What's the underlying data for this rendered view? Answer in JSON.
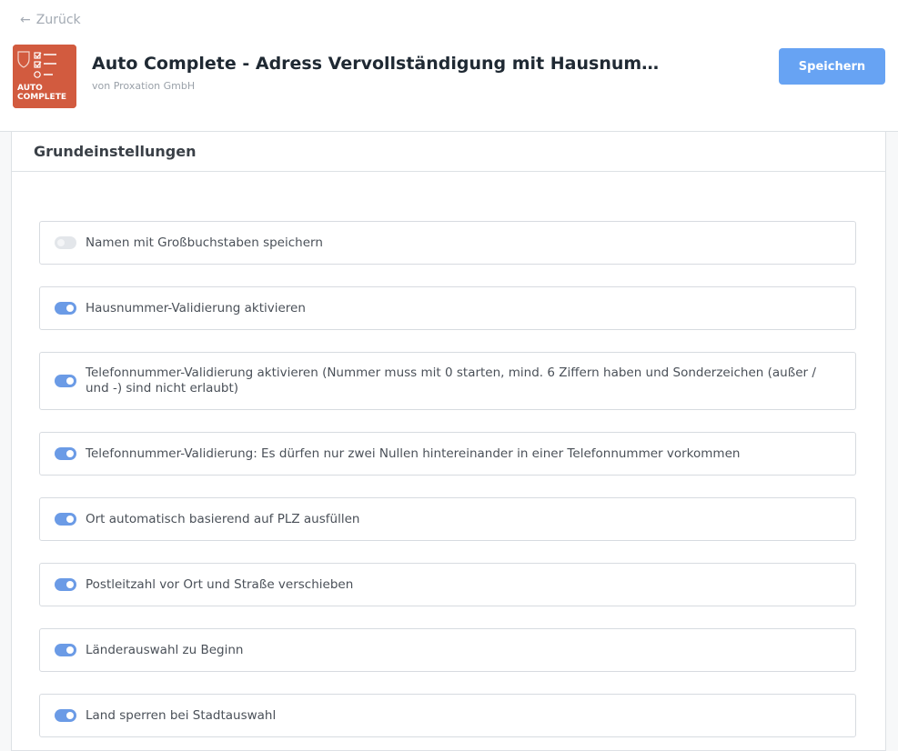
{
  "header": {
    "back_label": "Zurück",
    "app_title": "Auto Complete - Adress Vervollständigung mit Hausnum…",
    "vendor": "von Proxation GmbH",
    "save_label": "Speichern",
    "icon_text_line1": "AUTO",
    "icon_text_line2": "COMPLETE"
  },
  "card": {
    "title": "Grundeinstellungen"
  },
  "settings": [
    {
      "label": "Namen mit Großbuchstaben speichern",
      "enabled": false
    },
    {
      "label": "Hausnummer-Validierung aktivieren",
      "enabled": true
    },
    {
      "label": "Telefonnummer-Validierung aktivieren (Nummer muss mit 0 starten, mind. 6 Ziffern haben und Sonderzeichen (außer / und -) sind nicht erlaubt)",
      "enabled": true
    },
    {
      "label": "Telefonnummer-Validierung: Es dürfen nur zwei Nullen hintereinander in einer Telefonnummer vorkommen",
      "enabled": true
    },
    {
      "label": "Ort automatisch basierend auf PLZ ausfüllen",
      "enabled": true
    },
    {
      "label": "Postleitzahl vor Ort und Straße verschieben",
      "enabled": true
    },
    {
      "label": "Länderauswahl zu Beginn",
      "enabled": true
    },
    {
      "label": "Land sperren bei Stadtauswahl",
      "enabled": true
    }
  ],
  "colors": {
    "accent": "#67a3f3",
    "toggle_on": "#6b9be6",
    "icon_bg": "#d25b3f"
  }
}
